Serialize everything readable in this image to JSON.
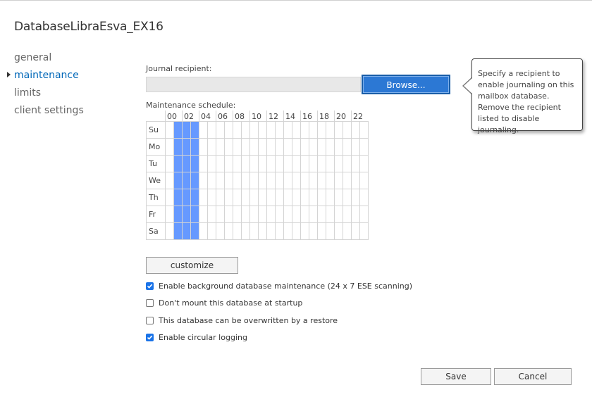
{
  "window": {
    "title": "DatabaseLibraEsva_EX16"
  },
  "nav": {
    "items": [
      {
        "label": "general",
        "active": false
      },
      {
        "label": "maintenance",
        "active": true
      },
      {
        "label": "limits",
        "active": false
      },
      {
        "label": "client settings",
        "active": false
      }
    ]
  },
  "journal": {
    "label": "Journal recipient:",
    "value": "",
    "browse_label": "Browse...",
    "tooltip": "Specify a recipient to enable journaling on this mailbox database. Remove the recipient listed to disable journaling."
  },
  "schedule": {
    "label": "Maintenance schedule:",
    "hour_labels": [
      "00",
      "02",
      "04",
      "06",
      "08",
      "10",
      "12",
      "14",
      "16",
      "18",
      "20",
      "22"
    ],
    "days": [
      "Su",
      "Mo",
      "Tu",
      "We",
      "Th",
      "Fr",
      "Sa"
    ],
    "active_color": "#6699ff",
    "active_hours_by_day": [
      [
        1,
        4
      ],
      [
        1,
        4
      ],
      [
        1,
        4
      ],
      [
        1,
        4
      ],
      [
        1,
        4
      ],
      [
        1,
        4
      ],
      [
        1,
        4
      ]
    ]
  },
  "customize_label": "customize",
  "options": [
    {
      "label": "Enable background database maintenance (24 x 7 ESE scanning)",
      "checked": true
    },
    {
      "label": "Don't mount this database at startup",
      "checked": false
    },
    {
      "label": "This database can be overwritten by a restore",
      "checked": false
    },
    {
      "label": "Enable circular logging",
      "checked": true
    }
  ],
  "footer": {
    "save_label": "Save",
    "cancel_label": "Cancel"
  },
  "colors": {
    "accent": "#0067b8",
    "button_primary": "#2c78d4",
    "checkbox_checked": "#1a73e8"
  }
}
